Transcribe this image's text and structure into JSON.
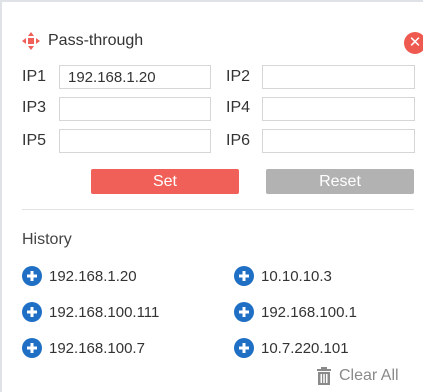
{
  "header": {
    "title": "Pass-through",
    "icon": "move-arrows-icon",
    "close_icon": "close-icon",
    "close_glyph": "✕"
  },
  "ip_fields": [
    {
      "label": "IP1",
      "value": "192.168.1.20"
    },
    {
      "label": "IP2",
      "value": ""
    },
    {
      "label": "IP3",
      "value": ""
    },
    {
      "label": "IP4",
      "value": ""
    },
    {
      "label": "IP5",
      "value": ""
    },
    {
      "label": "IP6",
      "value": ""
    }
  ],
  "actions": {
    "set_label": "Set",
    "reset_label": "Reset"
  },
  "history": {
    "title": "History",
    "items": [
      "192.168.1.20",
      "10.10.10.3",
      "192.168.100.111",
      "192.168.100.1",
      "192.168.100.7",
      "10.7.220.101"
    ],
    "item_icon": "add-circle-icon",
    "clear_all_label": "Clear All",
    "clear_icon": "trash-icon"
  },
  "colors": {
    "accent_red": "#f06059",
    "close_red": "#ef5a50",
    "reset_gray": "#b2b2b2",
    "history_blue": "#1f6fc5"
  }
}
